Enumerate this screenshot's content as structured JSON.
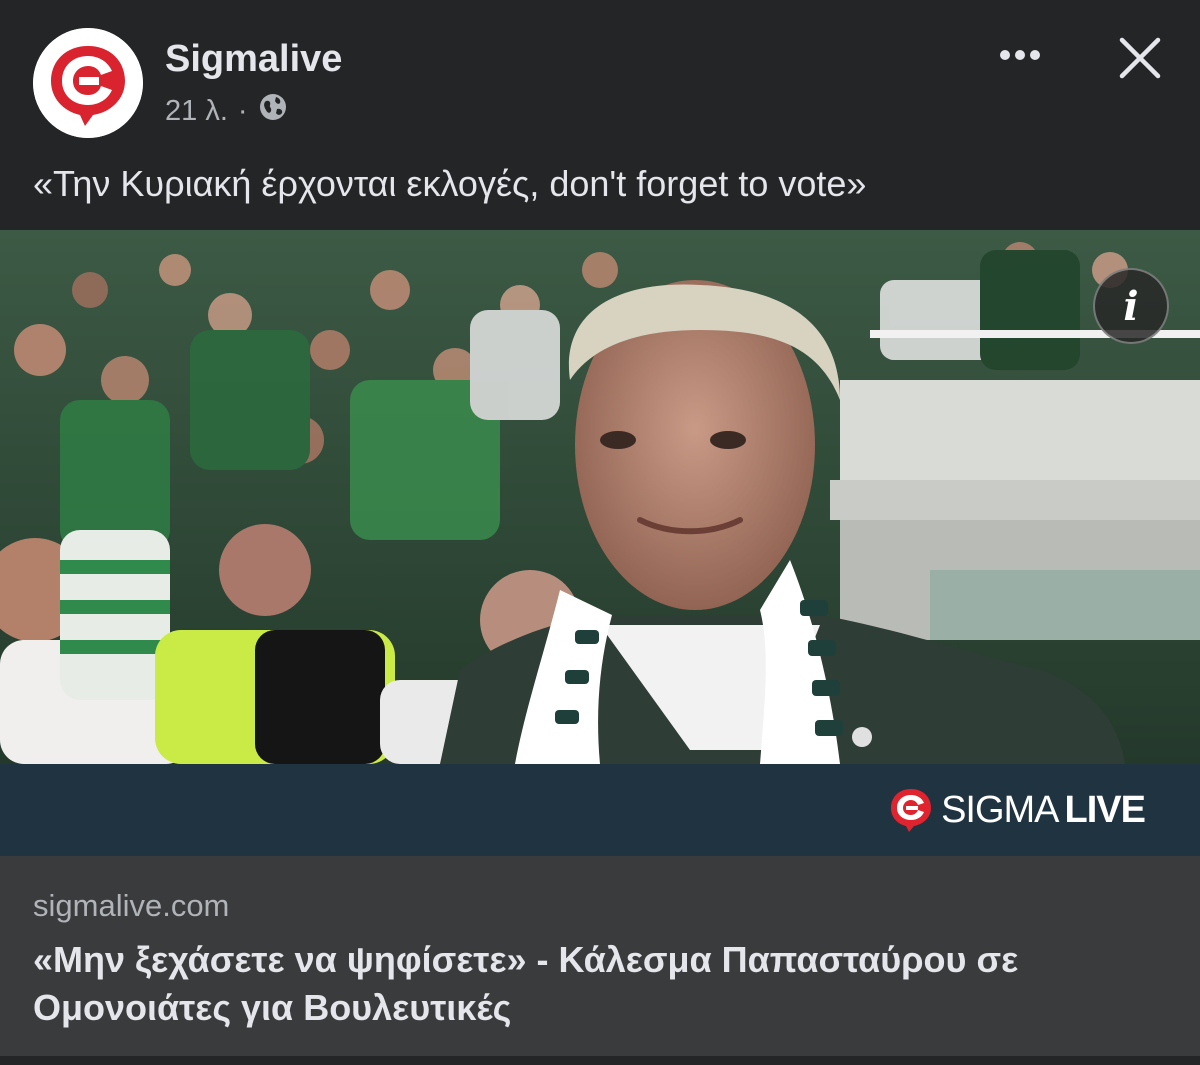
{
  "post": {
    "page_name": "Sigmalive",
    "time": "21 λ.",
    "separator": "·",
    "privacy_icon": "globe-icon",
    "caption": "«Την Κυριακή έρχονται εκλογές, don't forget to vote»"
  },
  "header_actions": {
    "more_icon": "more-horizontal-icon",
    "close_icon": "close-icon"
  },
  "photo": {
    "description_icon": "info-icon",
    "info_label": "i"
  },
  "banner": {
    "logo_text_a": "SIGMA",
    "logo_text_b": "LIVE",
    "brand_color": "#e0242f"
  },
  "link": {
    "domain": "sigmalive.com",
    "headline": "«Μην ξεχάσετε να ψηφίσετε» - Κάλεσμα Παπασταύρου σε Ομονοιάτες για Βουλευτικές"
  }
}
